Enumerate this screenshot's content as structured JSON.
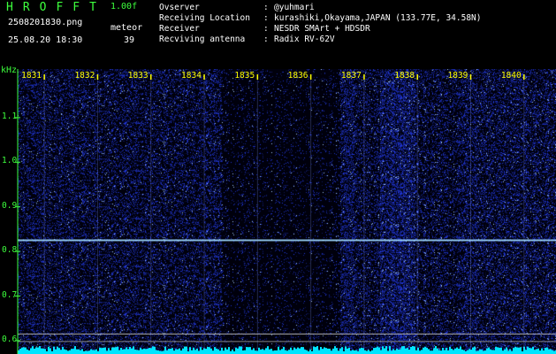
{
  "header": {
    "app_title": "HROFFT",
    "version": "1.00f",
    "filename": "2508201830.png",
    "mode": "meteor",
    "datetime": "25.08.20 18:30",
    "count": "39"
  },
  "station_info": [
    {
      "label": "Ovserver",
      "value": "@yuhmari"
    },
    {
      "label": "Receiving Location",
      "value": "kurashiki,Okayama,JAPAN (133.77E, 34.58N)"
    },
    {
      "label": "Receiver",
      "value": "NESDR SMArt + HDSDR"
    },
    {
      "label": "Recviving antenna",
      "value": "Radix RV-62V"
    }
  ],
  "y_axis": {
    "unit": "kHz",
    "ticks": [
      "1.1",
      "1.0",
      "0.9",
      "0.8",
      "0.7",
      "0.6"
    ],
    "range": [
      0.58,
      1.195
    ]
  },
  "x_axis": {
    "ticks": [
      "1831",
      "1832",
      "1833",
      "1834",
      "1835",
      "1836",
      "1837",
      "1838",
      "1839",
      "1840"
    ],
    "range_minutes": [
      1830.5,
      1840.6
    ]
  },
  "colors": {
    "header_green": "#3dff3d",
    "header_white": "#ffffff",
    "tick_yellow": "#ffff00",
    "background": "#000000",
    "noise_blue": "#2a3cff",
    "signal_cyan": "#9fd8ff",
    "bottom_band_cyan": "#00e5ff"
  }
}
